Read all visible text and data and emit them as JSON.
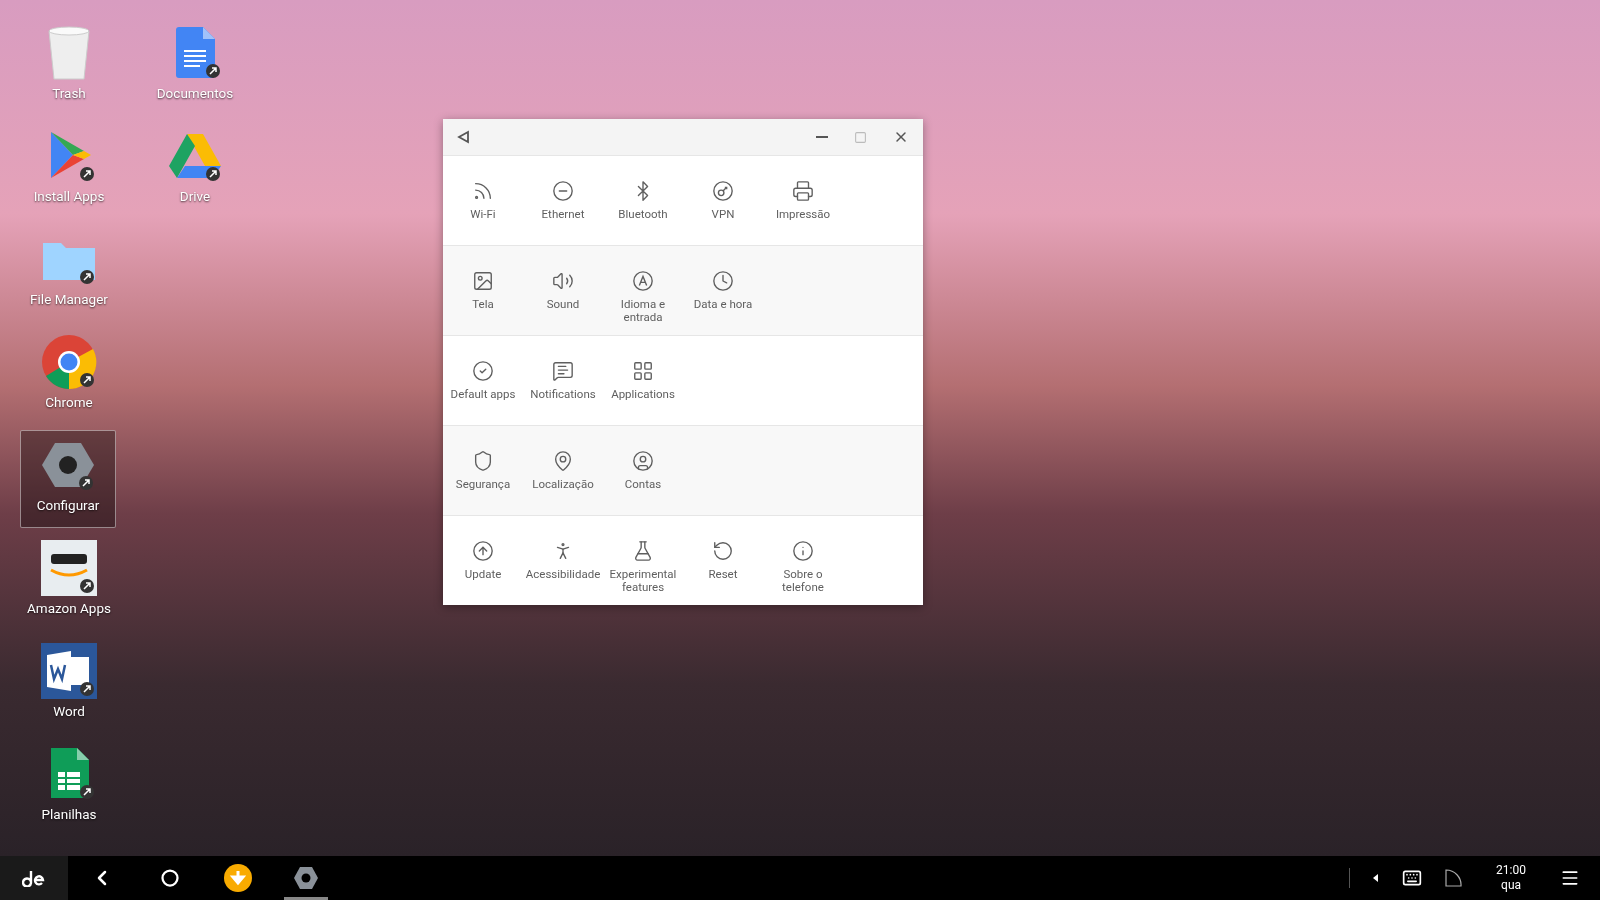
{
  "desktop_columns": [
    {
      "icons": [
        {
          "label": "Trash",
          "selected": false,
          "kind": "trash"
        },
        {
          "label": "Install Apps",
          "selected": false,
          "kind": "play"
        },
        {
          "label": "File Manager",
          "selected": false,
          "kind": "folder"
        },
        {
          "label": "Chrome",
          "selected": false,
          "kind": "chrome"
        },
        {
          "label": "Configurar",
          "selected": true,
          "kind": "gear"
        },
        {
          "label": "Amazon Apps",
          "selected": false,
          "kind": "amazon"
        },
        {
          "label": "Word",
          "selected": false,
          "kind": "word"
        },
        {
          "label": "Planilhas",
          "selected": false,
          "kind": "sheets"
        }
      ]
    },
    {
      "icons": [
        {
          "label": "Documentos",
          "selected": false,
          "kind": "docs"
        },
        {
          "label": "Drive",
          "selected": false,
          "kind": "drive"
        }
      ]
    }
  ],
  "settings_window": {
    "sections": [
      {
        "items": [
          {
            "label": "Wi-Fi"
          },
          {
            "label": "Ethernet"
          },
          {
            "label": "Bluetooth"
          },
          {
            "label": "VPN"
          },
          {
            "label": "Impressão"
          }
        ]
      },
      {
        "items": [
          {
            "label": "Tela"
          },
          {
            "label": "Sound"
          },
          {
            "label": "Idioma e entrada"
          },
          {
            "label": "Data e hora"
          }
        ]
      },
      {
        "items": [
          {
            "label": "Default apps"
          },
          {
            "label": "Notifications"
          },
          {
            "label": "Applications"
          }
        ]
      },
      {
        "items": [
          {
            "label": "Segurança"
          },
          {
            "label": "Localização"
          },
          {
            "label": "Contas"
          }
        ]
      },
      {
        "items": [
          {
            "label": "Update"
          },
          {
            "label": "Acessibilidade"
          },
          {
            "label": "Experimental features"
          },
          {
            "label": "Reset"
          },
          {
            "label": "Sobre o telefone"
          }
        ]
      }
    ]
  },
  "taskbar": {
    "apps": [
      {
        "kind": "download",
        "selected": false
      },
      {
        "kind": "gear",
        "selected": true
      }
    ],
    "clock": {
      "time": "21:00",
      "day": "qua"
    }
  }
}
